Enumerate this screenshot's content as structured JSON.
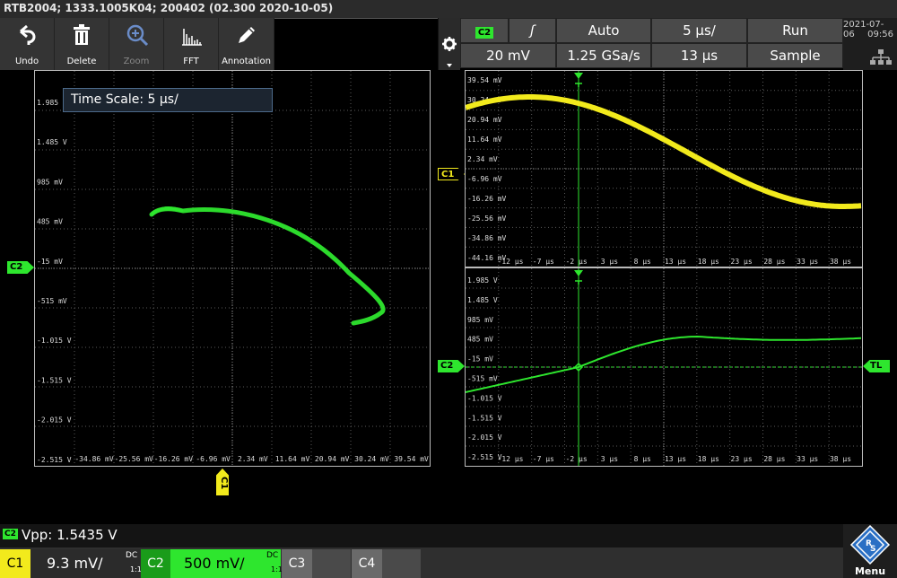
{
  "title": "RTB2004; 1333.1005K04; 200402 (02.300 2020-10-05)",
  "toolbar": {
    "undo": "Undo",
    "delete": "Delete",
    "zoom": "Zoom",
    "fft": "FFT",
    "annotation": "Annotation"
  },
  "trigger": {
    "source": "C2",
    "slope_symbol": "ʃ",
    "mode": "Auto",
    "time_scale": "5 µs/",
    "run_state": "Run",
    "level": "20 mV",
    "sample_rate": "1.25 GSa/s",
    "position": "13 µs",
    "acquisition": "Sample"
  },
  "date": "2021-07-06",
  "time": "09:56",
  "time_scale_box": "Time Scale: 5 µs/",
  "xy_plot": {
    "y_labels": [
      "1.985 V",
      "1.485 V",
      "985 mV",
      "485 mV",
      "-15 mV",
      "-515 mV",
      "-1.015 V",
      "-1.515 V",
      "-2.015 V",
      "-2.515 V"
    ],
    "x_labels": [
      "-34.86 mV",
      "-25.56 mV",
      "-16.26 mV",
      "-6.96 mV",
      "2.34 mV",
      "11.64 mV",
      "20.94 mV",
      "30.24 mV",
      "39.54 mV"
    ],
    "y_marker": "C2",
    "x_marker": "C1"
  },
  "c1_plot": {
    "y_labels": [
      "39.54 mV",
      "30.24 mV",
      "20.94 mV",
      "11.64 mV",
      "2.34 mV",
      "-6.96 mV",
      "-16.26 mV",
      "-25.56 mV",
      "-34.86 mV",
      "-44.16 mV"
    ],
    "x_labels": [
      "-12 µs",
      "-7 µs",
      "-2 µs",
      "3 µs",
      "8 µs",
      "13 µs",
      "18 µs",
      "23 µs",
      "28 µs",
      "33 µs",
      "38 µs"
    ],
    "marker": "C1"
  },
  "c2_plot": {
    "y_labels": [
      "1.985 V",
      "1.485 V",
      "985 mV",
      "485 mV",
      "-15 mV",
      "-515 mV",
      "-1.015 V",
      "-1.515 V",
      "-2.015 V",
      "-2.515 V"
    ],
    "x_labels": [
      "-12 µs",
      "-7 µs",
      "-2 µs",
      "3 µs",
      "8 µs",
      "13 µs",
      "18 µs",
      "23 µs",
      "28 µs",
      "33 µs",
      "38 µs"
    ],
    "marker": "C2",
    "trigger_level_marker": "TL"
  },
  "measurement": {
    "channel": "C2",
    "text": "Vpp: 1.5435 V"
  },
  "channels": {
    "c1": {
      "label": "C1",
      "scale": "9.3 mV/",
      "coupling": "DC",
      "probe": "1:1"
    },
    "c2": {
      "label": "C2",
      "scale": "500 mV/",
      "coupling": "DC",
      "probe": "1:1"
    },
    "c3": {
      "label": "C3"
    },
    "c4": {
      "label": "C4"
    }
  },
  "menu_label": "Menu",
  "colors": {
    "ch1": "#f2ea1c",
    "ch2": "#2ee62e",
    "grid": "#5a5a5a"
  }
}
